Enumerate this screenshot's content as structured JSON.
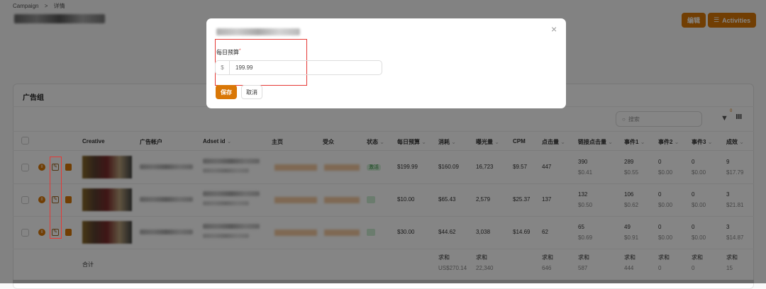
{
  "breadcrumb": {
    "root": "Campaign",
    "sep": ">",
    "current": "详情"
  },
  "header": {
    "edit_label": "编辑",
    "activities_label": "Activities"
  },
  "card": {
    "title": "广告组",
    "search_placeholder": "搜索",
    "filter_count": "0"
  },
  "table": {
    "columns": [
      "Creative",
      "广告帐户",
      "Adset id",
      "主页",
      "受众",
      "状态",
      "每日预算",
      "消耗",
      "曝光量",
      "CPM",
      "点击量",
      "链接点击量",
      "事件1",
      "事件2",
      "事件3",
      "成效"
    ],
    "rows": [
      {
        "status": "激活",
        "budget": "$199.99",
        "spend": "$160.09",
        "impr": "16,723",
        "cpm": "$9.57",
        "clicks": "447",
        "link": "390",
        "link_cost": "$0.41",
        "e1": "289",
        "e1_cost": "$0.55",
        "e2": "0",
        "e2_cost": "$0.00",
        "e3": "0",
        "e3_cost": "$0.00",
        "res": "9",
        "res_cost": "$17.79"
      },
      {
        "status": "",
        "budget": "$10.00",
        "spend": "$65.43",
        "impr": "2,579",
        "cpm": "$25.37",
        "clicks": "137",
        "link": "132",
        "link_cost": "$0.50",
        "e1": "106",
        "e1_cost": "$0.62",
        "e2": "0",
        "e2_cost": "$0.00",
        "e3": "0",
        "e3_cost": "$0.00",
        "res": "3",
        "res_cost": "$21.81"
      },
      {
        "status": "",
        "budget": "$30.00",
        "spend": "$44.62",
        "impr": "3,038",
        "cpm": "$14.69",
        "clicks": "62",
        "link": "65",
        "link_cost": "$0.69",
        "e1": "49",
        "e1_cost": "$0.91",
        "e2": "0",
        "e2_cost": "$0.00",
        "e3": "0",
        "e3_cost": "$0.00",
        "res": "3",
        "res_cost": "$14.87"
      }
    ],
    "total": {
      "label": "合计",
      "sum_label": "求和",
      "spend": "US$270.14",
      "impr": "22,340",
      "clicks": "646",
      "link": "587",
      "e1": "444",
      "e2": "0",
      "e3": "0",
      "res": "15"
    }
  },
  "modal": {
    "field_label": "每日预算",
    "required_mark": "*",
    "currency": "$",
    "value": "199.99",
    "save_label": "保存",
    "cancel_label": "取消",
    "close": "×"
  },
  "colors": {
    "accent": "#d97706",
    "highlight": "#e53935"
  }
}
